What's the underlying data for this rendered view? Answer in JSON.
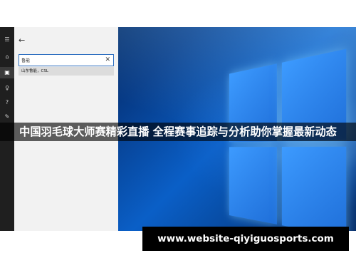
{
  "sidebar": {
    "icons": [
      {
        "name": "hamburger-icon",
        "glyph": "☰"
      },
      {
        "name": "home-icon",
        "glyph": "⌂"
      },
      {
        "name": "notebook-icon",
        "glyph": "▣"
      },
      {
        "name": "lightbulb-icon",
        "glyph": "♀"
      },
      {
        "name": "help-icon",
        "glyph": "?"
      },
      {
        "name": "feedback-icon",
        "glyph": "✎"
      }
    ]
  },
  "panel": {
    "back_glyph": "←",
    "search": {
      "value": "鲁能",
      "clear_glyph": "✕"
    },
    "suggestion": "山东鲁能，CSL"
  },
  "banner": {
    "text": "中国羽毛球大师赛精彩直播 全程赛事追踪与分析助你掌握最新动态"
  },
  "footer": {
    "url": "www.website-qiyiguosports.com"
  },
  "colors": {
    "desktop_blue": "#0a5fc7",
    "sidebar_bg": "#1f1f1f",
    "panel_bg": "#f2f2f2",
    "search_border": "#2b6dbf"
  }
}
